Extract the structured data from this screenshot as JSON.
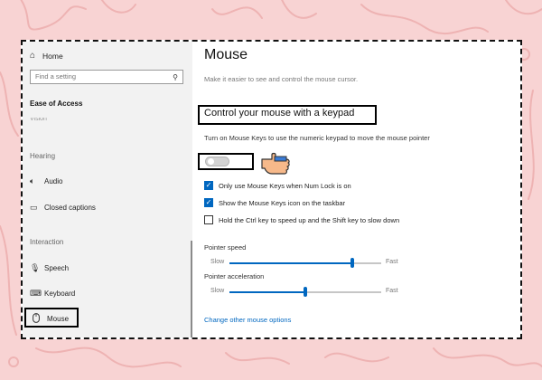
{
  "sidebar": {
    "home_label": "Home",
    "search_placeholder": "Find a setting",
    "category_title": "Ease of Access",
    "vision_partial": "Vision",
    "sections": [
      "Hearing",
      "Interaction"
    ],
    "items": [
      {
        "label": "Audio",
        "icon": "speaker-icon"
      },
      {
        "label": "Closed captions",
        "icon": "captions-icon"
      },
      {
        "label": "Speech",
        "icon": "microphone-icon"
      },
      {
        "label": "Keyboard",
        "icon": "keyboard-icon"
      },
      {
        "label": "Mouse",
        "icon": "mouse-icon",
        "selected": true
      }
    ]
  },
  "main": {
    "title": "Mouse",
    "description": "Make it easier to see and control the mouse cursor.",
    "section_heading": "Control your mouse with a keypad",
    "toggle_label": "Turn on Mouse Keys to use the numeric keypad to move the mouse pointer",
    "toggle_on": false,
    "checkboxes": [
      {
        "label": "Only use Mouse Keys when Num Lock is on",
        "checked": true
      },
      {
        "label": "Show the Mouse Keys icon on the taskbar",
        "checked": true
      },
      {
        "label": "Hold the Ctrl key to speed up and the Shift key to slow down",
        "checked": false
      }
    ],
    "sliders": [
      {
        "label": "Pointer speed",
        "min_label": "Slow",
        "max_label": "Fast",
        "value": 0.81
      },
      {
        "label": "Pointer acceleration",
        "min_label": "Slow",
        "max_label": "Fast",
        "value": 0.5
      }
    ],
    "link": "Change other mouse options"
  },
  "colors": {
    "accent": "#0067c0",
    "background": "#f8d3d3",
    "annotation_border": "#000000"
  }
}
